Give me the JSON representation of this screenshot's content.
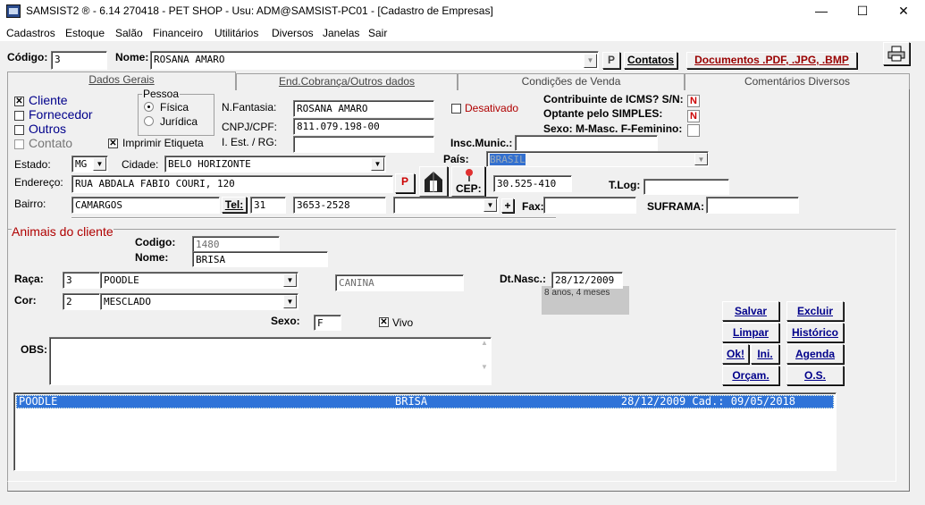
{
  "window": {
    "title": "SAMSIST2 ® - 6.14  270418 - PET SHOP - Usu: ADM@SAMSIST-PC01 - [Cadastro de Empresas]",
    "min": "—",
    "max": "☐",
    "close": "✕"
  },
  "menu": [
    "Cadastros",
    "Estoque",
    "Salão",
    "Financeiro",
    "Utilitários",
    "Diversos",
    "Janelas",
    "Sair"
  ],
  "header": {
    "codigo_label": "Código:",
    "codigo": "3",
    "nome_label": "Nome:",
    "nome": "ROSANA AMARO",
    "p_btn": "P",
    "contatos_btn": "Contatos",
    "docs_btn": "Documentos .PDF, .JPG, .BMP"
  },
  "tabs": [
    "Dados Gerais",
    "End.Cobrança/Outros dados",
    "Condições de Venda",
    "Comentários Diversos"
  ],
  "types": {
    "cliente": "Cliente",
    "fornecedor": "Fornecedor",
    "outros": "Outros",
    "contato": "Contato",
    "imprimir": "Imprimir Etiqueta"
  },
  "pessoa": {
    "label": "Pessoa",
    "fisica": "Física",
    "juridica": "Jurídica"
  },
  "fields": {
    "fantasia_label": "N.Fantasia:",
    "fantasia": "ROSANA AMARO",
    "cnpj_label": "CNPJ/CPF:",
    "cnpj": "811.079.198-00",
    "ie_label": "I. Est. / RG:",
    "ie": "",
    "desativado": "Desativado",
    "icms_label": "Contribuinte de ICMS? S/N:",
    "icms": "N",
    "simples_label": "Optante pelo SIMPLES:",
    "simples": "N",
    "sexo_label": "Sexo: M-Masc. F-Feminino:",
    "sexo": "",
    "munic_label": "Insc.Munic.:",
    "pais_label": "País:",
    "pais": "BRASIL",
    "estado_label": "Estado:",
    "estado": "MG",
    "cidade_label": "Cidade:",
    "cidade": "BELO HORIZONTE",
    "endereco_label": "Endereço:",
    "endereco": "RUA ABDALA FABIO COURI, 120",
    "p_btn": "P",
    "cep_label": "CEP:",
    "cep": "30.525-410",
    "tlog_label": "T.Log:",
    "bairro_label": "Bairro:",
    "bairro": "CAMARGOS",
    "tel_btn": "Tel:",
    "ddd": "31",
    "tel": "3653-2528",
    "plus": "+",
    "fax_label": "Fax:",
    "suframa_label": "SUFRAMA:"
  },
  "animal": {
    "section": "Animais do cliente",
    "codigo_label": "Codigo:",
    "codigo": "1480",
    "nome_label": "Nome:",
    "nome": "BRISA",
    "raca_label": "Raça:",
    "raca_cod": "3",
    "raca": "POODLE",
    "especie": "CANINA",
    "dtnasc_label": "Dt.Nasc.:",
    "dtnasc": "28/12/2009",
    "idade": "8 anos,  4 meses",
    "cor_label": "Cor:",
    "cor_cod": "2",
    "cor": "MESCLADO",
    "sexo_label": "Sexo:",
    "sexo": "F",
    "vivo": "Vivo",
    "obs_label": "OBS:"
  },
  "buttons": {
    "salvar": "Salvar",
    "excluir": "Excluir",
    "limpar": "Limpar",
    "historico": "Histórico",
    "ok": "Ok!",
    "ini": "Ini.",
    "agenda": "Agenda",
    "orcam": "Orçam.",
    "os": "O.S."
  },
  "list": [
    {
      "raca": "POODLE",
      "nome": "BRISA",
      "info": "28/12/2009 Cad.: 09/05/2018"
    }
  ]
}
